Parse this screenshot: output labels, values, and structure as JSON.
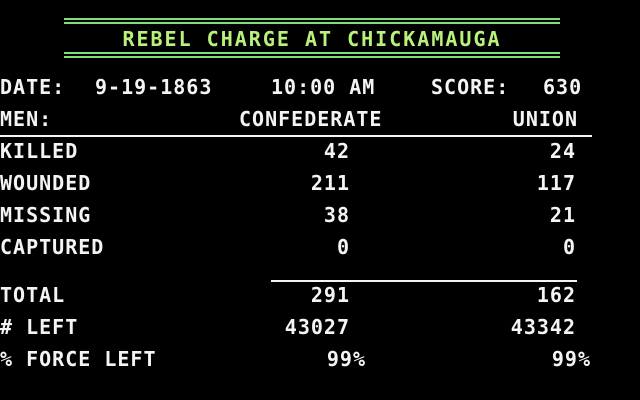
{
  "title": "REBEL CHARGE AT CHICKAMAUGA",
  "status": {
    "date_label": "DATE:",
    "date": "9-19-1863",
    "time": "10:00 AM",
    "score_label": "SCORE:",
    "score": "630"
  },
  "table": {
    "header_label": "MEN:",
    "col_confederate": "CONFEDERATE",
    "col_union": "UNION",
    "rows": [
      {
        "label": "KILLED",
        "confederate": "42",
        "union": "24"
      },
      {
        "label": "WOUNDED",
        "confederate": "211",
        "union": "117"
      },
      {
        "label": "MISSING",
        "confederate": "38",
        "union": "21"
      },
      {
        "label": "CAPTURED",
        "confederate": "0",
        "union": "0"
      }
    ],
    "totals": [
      {
        "label": "TOTAL",
        "confederate": "291",
        "union": "162"
      },
      {
        "label": "# LEFT",
        "confederate": "43027",
        "union": "43342"
      },
      {
        "label": "% FORCE LEFT",
        "confederate": "99%",
        "union": "99%"
      }
    ]
  },
  "colors": {
    "background": "#000000",
    "text": "#f4f4f4",
    "title_text": "#b9f27a",
    "title_rule": "#7fe07a"
  }
}
